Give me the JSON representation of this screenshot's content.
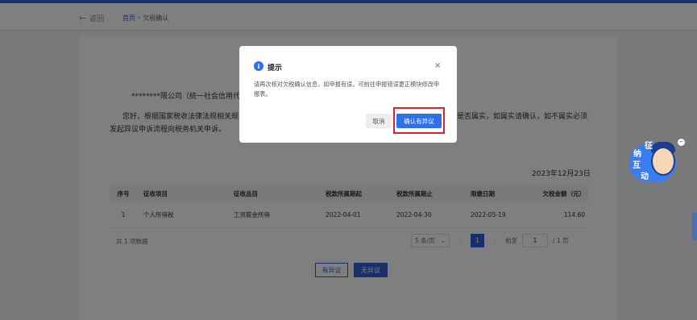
{
  "nav": {
    "back_label": "返回",
    "breadcrumb_home": "首页",
    "breadcrumb_sep": "›",
    "breadcrumb_current": "欠税确认"
  },
  "notice": {
    "company": "********限公司（统一社会信用代",
    "line1_start": "您好，根据国家税收法律法规相关规",
    "line1_end": "是否属实，如属实请确认，如不属实必须",
    "line2": "发起异议申诉流程向税务机关申诉。"
  },
  "date": "2023年12月23日",
  "table": {
    "headers": [
      "序号",
      "征收项目",
      "征收品目",
      "税款所属期起",
      "税款所属期止",
      "限缴日期",
      "欠税金额（元）"
    ],
    "rows": [
      [
        "1",
        "个人所得税",
        "工资薪金所得",
        "2022-04-01",
        "2022-04-30",
        "2022-05-19",
        "114.60"
      ]
    ]
  },
  "pagination": {
    "total": "共 1 项数据",
    "page_size": "5 条/页",
    "prev": "‹",
    "current_page": "1",
    "next": "›",
    "jump_label": "前至",
    "jump_value": "1",
    "total_pages": "/ 1 页"
  },
  "actions": {
    "dispute": "有异议",
    "no_dispute": "无异议"
  },
  "modal": {
    "title": "提示",
    "close": "×",
    "message": "请再次核对欠税确认信息，如申报有误，可前往申报错误更正模块修改申报表。",
    "cancel": "取消",
    "confirm": "确认有异议"
  },
  "mascot": {
    "chars": [
      "征",
      "纳",
      "互",
      "动"
    ],
    "close": "−"
  },
  "colors": {
    "brand": "#2f5ed6",
    "highlight": "#e0202a"
  }
}
